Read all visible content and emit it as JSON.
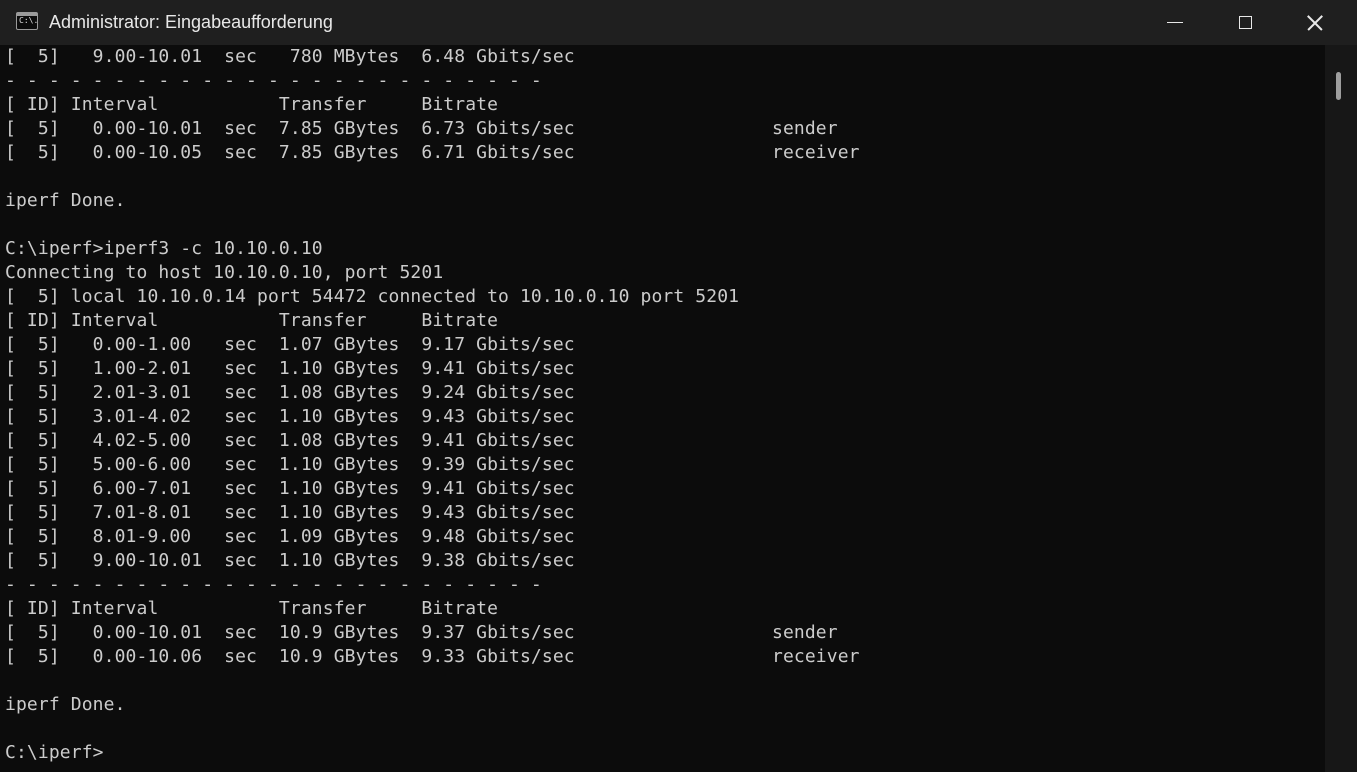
{
  "window": {
    "title": "Administrator: Eingabeaufforderung",
    "icon_text": "C:\\."
  },
  "icons": {
    "app": "command-prompt-icon",
    "minimize": "minimize-icon",
    "maximize": "maximize-icon",
    "close": "close-icon"
  },
  "colors": {
    "background": "#0c0c0c",
    "titlebar": "#1f1f1f",
    "text": "#cccccc"
  },
  "console": {
    "lines": [
      "[  5]   9.00-10.01  sec   780 MBytes  6.48 Gbits/sec",
      "- - - - - - - - - - - - - - - - - - - - - - - - -",
      "[ ID] Interval           Transfer     Bitrate",
      "[  5]   0.00-10.01  sec  7.85 GBytes  6.73 Gbits/sec                  sender",
      "[  5]   0.00-10.05  sec  7.85 GBytes  6.71 Gbits/sec                  receiver",
      "",
      "iperf Done.",
      "",
      "C:\\iperf>iperf3 -c 10.10.0.10",
      "Connecting to host 10.10.0.10, port 5201",
      "[  5] local 10.10.0.14 port 54472 connected to 10.10.0.10 port 5201",
      "[ ID] Interval           Transfer     Bitrate",
      "[  5]   0.00-1.00   sec  1.07 GBytes  9.17 Gbits/sec",
      "[  5]   1.00-2.01   sec  1.10 GBytes  9.41 Gbits/sec",
      "[  5]   2.01-3.01   sec  1.08 GBytes  9.24 Gbits/sec",
      "[  5]   3.01-4.02   sec  1.10 GBytes  9.43 Gbits/sec",
      "[  5]   4.02-5.00   sec  1.08 GBytes  9.41 Gbits/sec",
      "[  5]   5.00-6.00   sec  1.10 GBytes  9.39 Gbits/sec",
      "[  5]   6.00-7.01   sec  1.10 GBytes  9.41 Gbits/sec",
      "[  5]   7.01-8.01   sec  1.10 GBytes  9.43 Gbits/sec",
      "[  5]   8.01-9.00   sec  1.09 GBytes  9.48 Gbits/sec",
      "[  5]   9.00-10.01  sec  1.10 GBytes  9.38 Gbits/sec",
      "- - - - - - - - - - - - - - - - - - - - - - - - -",
      "[ ID] Interval           Transfer     Bitrate",
      "[  5]   0.00-10.01  sec  10.9 GBytes  9.37 Gbits/sec                  sender",
      "[  5]   0.00-10.06  sec  10.9 GBytes  9.33 Gbits/sec                  receiver",
      "",
      "iperf Done.",
      "",
      "C:\\iperf>"
    ]
  }
}
